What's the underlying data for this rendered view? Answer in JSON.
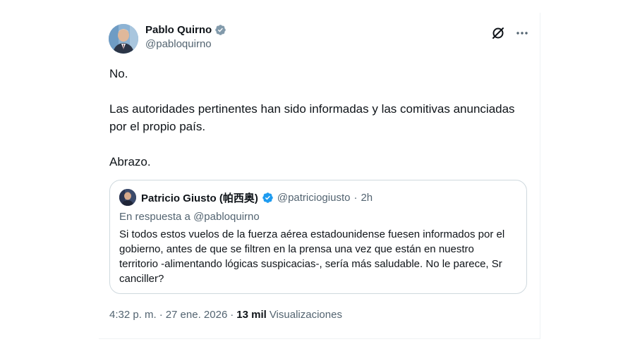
{
  "author": {
    "name": "Pablo Quirno",
    "handle": "@pabloquirno",
    "verified": true,
    "badge_color": "#829aab"
  },
  "header_actions": {
    "grok_icon": "grok-icon",
    "more_icon": "more-icon"
  },
  "tweet": {
    "paragraphs": [
      "No.",
      "Las autoridades pertinentes han sido informadas y las comitivas anunciadas por el propio país.",
      "Abrazo."
    ]
  },
  "quote": {
    "name": "Patricio Giusto (帕西奥)",
    "handle": "@patriciogiusto",
    "separator": "·",
    "time": "2h",
    "verified": true,
    "badge_color": "#1d9bf0",
    "reply_prefix": "En respuesta a",
    "reply_mention": "@pabloquirno",
    "text": "Si todos estos vuelos de la fuerza aérea estadounidense fuesen informados por el gobierno, antes de que se filtren en la prensa una vez que están en nuestro territorio -alimentando lógicas suspicacias-, sería más saludable. No le parece, Sr canciller?"
  },
  "meta": {
    "time": "4:32 p. m.",
    "separator1": "·",
    "date": "27 ene. 2026",
    "separator2": "·",
    "views_count": "13 mil",
    "views_label": "Visualizaciones"
  }
}
